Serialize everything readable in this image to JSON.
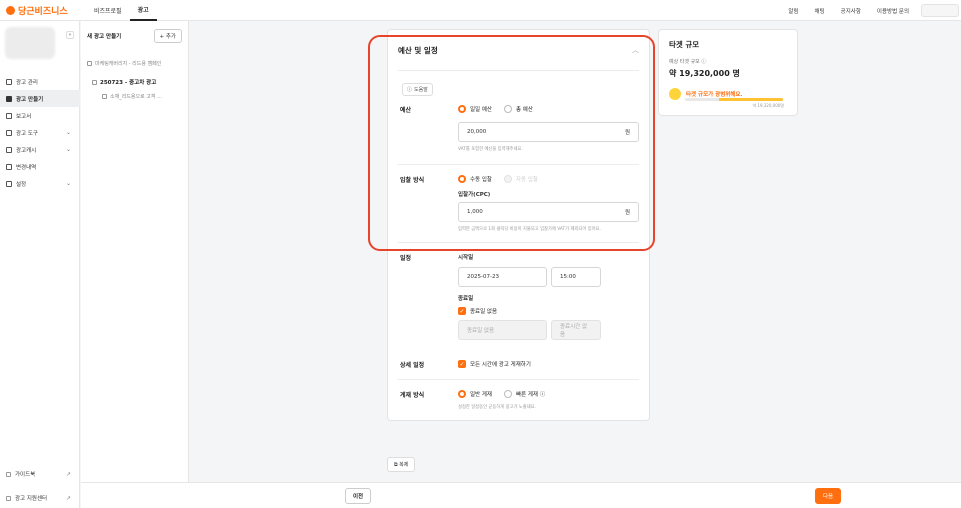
{
  "app": {
    "logo_text": "당근비즈니스",
    "brand_color": "#ff6f0f"
  },
  "topnav": {
    "items": [
      "비즈프로필",
      "광고"
    ],
    "active": "광고"
  },
  "topright": {
    "items": [
      "알림",
      "채팅",
      "공지사항",
      "이용방법 문의"
    ]
  },
  "sidebar": {
    "collapse_icon": "«",
    "items": [
      {
        "label": "광고 관리",
        "icon": "megaphone-icon"
      },
      {
        "label": "광고 만들기",
        "icon": "create-icon",
        "active": true
      },
      {
        "label": "보고서",
        "icon": "report-icon"
      },
      {
        "label": "광고 도구",
        "icon": "tools-icon",
        "chevron": "⌄"
      },
      {
        "label": "광고캐시",
        "icon": "cash-icon",
        "chevron": "⌄"
      },
      {
        "label": "변경내역",
        "icon": "history-icon"
      },
      {
        "label": "설정",
        "icon": "settings-icon",
        "chevron": "⌄"
      }
    ],
    "bottom": [
      {
        "label": "가이드북",
        "icon": "guide-icon",
        "ext": "↗"
      },
      {
        "label": "광고 지원센터",
        "icon": "support-icon",
        "ext": "↗"
      }
    ]
  },
  "tree": {
    "title": "새 광고 만들기",
    "add_label": "+ 추가",
    "campaign": "마케팅캐버리지 - 리드용 캠페인",
    "group": "250723 - 중고차 광고",
    "material": "소재_리드용으로 고객 ..."
  },
  "section": {
    "title": "예산 및 일정",
    "chevron": "︿",
    "help_label": "도움말",
    "budget": {
      "label": "예산",
      "options": [
        "일일 예산",
        "총 예산"
      ],
      "value": "20,000",
      "unit": "원",
      "hint": "VAT를 포함한 예산을 입력해주세요."
    },
    "bid": {
      "label": "입찰 방식",
      "options": [
        "수동 입찰",
        "자동 입찰"
      ],
      "price_label": "입찰가(CPC)",
      "value": "1,000",
      "unit": "원",
      "hint": "입력한 금액으로 1회 클릭당 비용이 지불되고 입찰가에 VAT가 제외되어 있어요."
    },
    "schedule": {
      "label": "일정",
      "start_label": "시작일",
      "start_date": "2025-07-23",
      "start_time": "15:00",
      "end_label": "종료일",
      "no_end_label": "종료일 없음",
      "end_date_placeholder": "종료일 없음",
      "end_time_placeholder": "종료시간 없음"
    },
    "detail": {
      "label": "상세 일정",
      "checkbox_label": "모든 시간에 광고 게재하기"
    },
    "delivery": {
      "label": "게재 방식",
      "options": [
        "일반 게재",
        "빠른 게재 ⓘ"
      ],
      "hint": "설정한 일정동안 균등하게 광고가 노출돼요."
    }
  },
  "copy_label": "복제",
  "target": {
    "title": "타겟 규모",
    "sub": "예상 타겟 규모 ⓘ",
    "value": "약 19,320,000 명",
    "message": "타겟 규모가 광범위해요.",
    "gauge_label": "약 19,320,000명",
    "gauge_level": 0.65
  },
  "footer": {
    "prev": "이전",
    "next": "다음"
  }
}
